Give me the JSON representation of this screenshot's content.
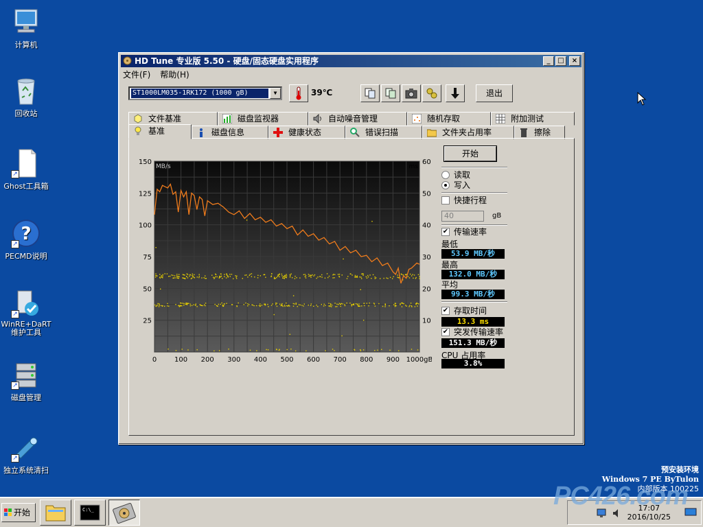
{
  "desktop": {
    "icons": [
      {
        "label": "计算机"
      },
      {
        "label": "回收站"
      },
      {
        "label": "Ghost工具箱"
      },
      {
        "label": "PECMD说明"
      },
      {
        "label": "WinRE+DaRT\n维护工具"
      },
      {
        "label": "磁盘管理"
      },
      {
        "label": "独立系统清扫"
      }
    ],
    "pe_info": {
      "line1": "预安装环境",
      "line2": "Windows 7 PE ByTulon",
      "line3": "内部版本 100225"
    },
    "watermark": "PC426.com"
  },
  "window": {
    "title": "HD Tune 专业版 5.50 - 硬盘/固态硬盘实用程序",
    "menu": [
      "文件(F)",
      "帮助(H)"
    ],
    "drive": "ST1000LM035-1RK172 (1000 gB)",
    "temperature": "39℃",
    "exit_label": "退出",
    "tabs_top": [
      "文件基准",
      "磁盘监视器",
      "自动噪音管理",
      "随机存取",
      "附加测试"
    ],
    "tabs_bottom": [
      "基准",
      "磁盘信息",
      "健康状态",
      "错误扫描",
      "文件夹占用率",
      "擦除"
    ],
    "active_tab": "基准",
    "right_panel": {
      "start_label": "开始",
      "read_label": "读取",
      "write_label": "写入",
      "quick_label": "快捷行程",
      "quick_value": "40",
      "quick_unit": "gB",
      "transfer_label": "传输速率",
      "min_label": "最低",
      "min_value": "53.9 MB/秒",
      "max_label": "最高",
      "max_value": "132.0 MB/秒",
      "avg_label": "平均",
      "avg_value": "99.3 MB/秒",
      "access_label": "存取时间",
      "access_value": "13.3 ms",
      "burst_label": "突发传输速率",
      "burst_value": "151.3 MB/秒",
      "cpu_label": "CPU 占用率",
      "cpu_value": "3.8%"
    }
  },
  "taskbar": {
    "start_label": "开始",
    "clock_time": "17:07",
    "clock_date": "2016/10/25"
  },
  "chart_data": {
    "type": "line",
    "y1label": "MB/s",
    "y2label": "ms",
    "y1lim": [
      0,
      150
    ],
    "y2lim": [
      0,
      60
    ],
    "y1ticks": [
      "150",
      "125",
      "100",
      "75",
      "50",
      "25"
    ],
    "y2ticks": [
      "60",
      "50",
      "40",
      "30",
      "20",
      "10"
    ],
    "xlim": [
      0,
      1000
    ],
    "xticks": [
      "0",
      "100",
      "200",
      "300",
      "400",
      "500",
      "600",
      "700",
      "800",
      "900",
      "1000gB"
    ],
    "series": [
      {
        "x": [
          0,
          10,
          20,
          30,
          40,
          50,
          60,
          70,
          80,
          90,
          100,
          110,
          120,
          130,
          140,
          150,
          160,
          170,
          180,
          190,
          200,
          220,
          240,
          260,
          280,
          300,
          320,
          340,
          360,
          380,
          400,
          420,
          440,
          460,
          480,
          500,
          520,
          540,
          560,
          580,
          600,
          620,
          640,
          660,
          680,
          700,
          720,
          740,
          760,
          780,
          800,
          820,
          840,
          860,
          880,
          900,
          910,
          920,
          930,
          940,
          950,
          960,
          970,
          980,
          990,
          1000
        ],
        "values": [
          108,
          128,
          126,
          131,
          130,
          129,
          132,
          124,
          126,
          110,
          127,
          122,
          126,
          108,
          125,
          123,
          112,
          122,
          120,
          107,
          119,
          116,
          117,
          114,
          110,
          108,
          111,
          105,
          109,
          104,
          106,
          102,
          104,
          99,
          101,
          97,
          99,
          92,
          96,
          91,
          93,
          88,
          90,
          85,
          87,
          80,
          83,
          78,
          80,
          75,
          76,
          71,
          74,
          68,
          70,
          63,
          61,
          66,
          54,
          60,
          58,
          65,
          66,
          68,
          70,
          69
        ]
      },
      {
        "values_ms_band": [
          24,
          15,
          0.5
        ]
      }
    ]
  }
}
